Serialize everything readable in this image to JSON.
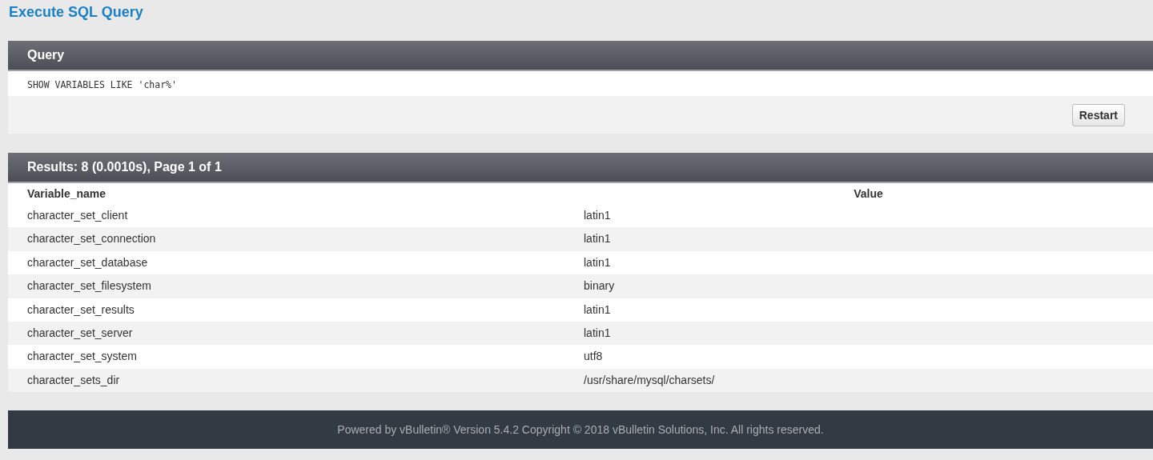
{
  "page_title": "Execute SQL Query",
  "query_panel": {
    "title": "Query",
    "query": "SHOW VARIABLES LIKE 'char%'",
    "button": "Restart"
  },
  "results_panel": {
    "title": "Results: 8 (0.0010s), Page 1 of 1",
    "columns": [
      "Variable_name",
      "Value"
    ],
    "rows": [
      [
        "character_set_client",
        "latin1"
      ],
      [
        "character_set_connection",
        "latin1"
      ],
      [
        "character_set_database",
        "latin1"
      ],
      [
        "character_set_filesystem",
        "binary"
      ],
      [
        "character_set_results",
        "latin1"
      ],
      [
        "character_set_server",
        "latin1"
      ],
      [
        "character_set_system",
        "utf8"
      ],
      [
        "character_sets_dir",
        "/usr/share/mysql/charsets/"
      ]
    ]
  },
  "footer": "Powered by vBulletin® Version 5.4.2 Copyright © 2018 vBulletin Solutions, Inc. All rights reserved."
}
